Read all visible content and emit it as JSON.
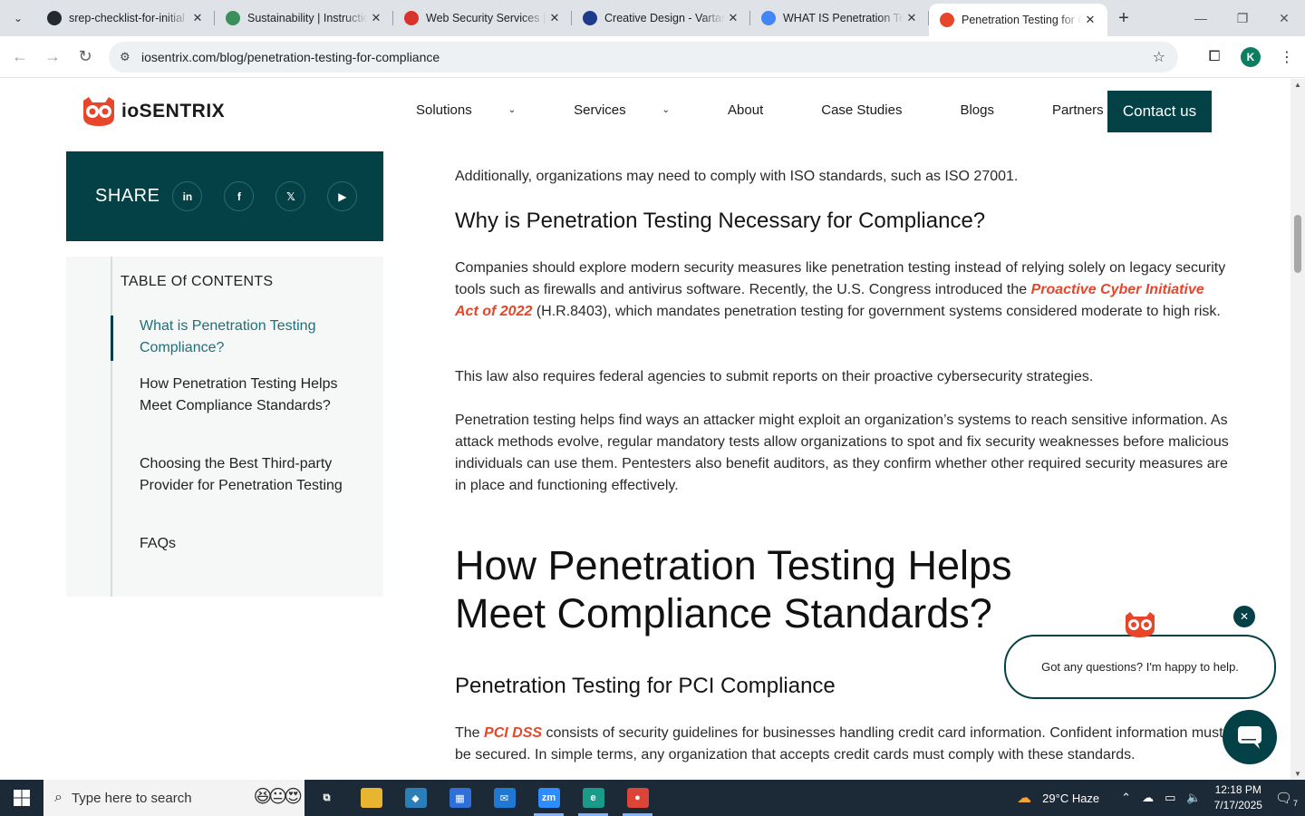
{
  "browser": {
    "tabs": [
      {
        "title": "srep-checklist-for-initial",
        "favicon": "github-icon",
        "color": "#24292f"
      },
      {
        "title": "Sustainability | Instructio",
        "favicon": "leaf-icon",
        "color": "#3a8f5a"
      },
      {
        "title": "Web Security Services |",
        "favicon": "shield-icon",
        "color": "#d9342b"
      },
      {
        "title": "Creative Design - Vartar",
        "favicon": "x-logo-icon",
        "color": "#1e3a8a"
      },
      {
        "title": "WHAT IS Penetration Te",
        "favicon": "google-icon",
        "color": "#4285f4"
      },
      {
        "title": "Penetration Testing for C",
        "favicon": "owl-icon",
        "color": "#e8462a",
        "active": true
      }
    ],
    "url": "iosentrix.com/blog/penetration-testing-for-compliance",
    "profile_initial": "K"
  },
  "site": {
    "brand": "ioSENTRIX",
    "nav": [
      {
        "label": "Solutions",
        "dropdown": true
      },
      {
        "label": "Services",
        "dropdown": true
      },
      {
        "label": "About"
      },
      {
        "label": "Case Studies"
      },
      {
        "label": "Blogs"
      },
      {
        "label": "Partners"
      }
    ],
    "contact_label": "Contact us",
    "accent": "#044147",
    "link_color": "#e8462a"
  },
  "share": {
    "label": "SHARE",
    "icons": [
      {
        "glyph": "in",
        "name": "linkedin-icon"
      },
      {
        "glyph": "f",
        "name": "facebook-icon"
      },
      {
        "glyph": "𝕏",
        "name": "x-twitter-icon"
      },
      {
        "glyph": "▶",
        "name": "youtube-icon"
      }
    ]
  },
  "toc": {
    "heading": "TABLE Of CONTENTS",
    "items": [
      "What is Penetration Testing Compliance?",
      "How Penetration Testing Helps Meet Compliance Standards?",
      "Choosing the Best Third-party Provider for Penetration Testing",
      "FAQs"
    ]
  },
  "article": {
    "p_iso": "Additionally, organizations may need to comply with ISO standards, such as ISO 27001.",
    "h2_why": "Why is Penetration Testing Necessary for Compliance?",
    "p1_before": "Companies should explore modern security measures like penetration testing instead of relying solely on legacy security tools such as firewalls and antivirus software. Recently, the U.S. Congress introduced the ",
    "p1_link": "Proactive Cyber Initiative Act of 2022",
    "p1_after": " (H.R.8403), which mandates penetration testing for government systems considered moderate to high risk.",
    "p2": "This law also requires federal agencies to submit reports on their proactive cybersecurity strategies.",
    "p3": "Penetration testing helps find ways an attacker might exploit an organization’s systems to reach sensitive information. As attack methods evolve, regular mandatory tests allow organizations to spot and fix security weaknesses before malicious individuals can use them. Pentesters also benefit auditors, as they confirm whether other required security measures are in place and functioning effectively.",
    "h1_how": "How Penetration Testing Helps Meet Compliance Standards?",
    "h2_pci": "Penetration Testing for PCI Compliance",
    "p4_before": "The ",
    "p4_link": "PCI DSS",
    "p4_after": " consists of security guidelines for businesses handling credit card information. Confident information must be secured. In simple terms, any organization that accepts credit cards must comply with these standards."
  },
  "chat": {
    "message": "Got any questions? I'm happy to help."
  },
  "taskbar": {
    "search_placeholder": "Type here to search",
    "apps": [
      {
        "name": "task-view-icon",
        "glyph": "⧉",
        "color": "transparent"
      },
      {
        "name": "file-explorer-icon",
        "glyph": "",
        "color": "#e8b530"
      },
      {
        "name": "vscode-icon",
        "glyph": "◆",
        "color": "#2b7fb8"
      },
      {
        "name": "store-icon",
        "glyph": "▦",
        "color": "#2f6fd6"
      },
      {
        "name": "mail-icon",
        "glyph": "✉",
        "color": "#1f78d1"
      },
      {
        "name": "zoom-icon",
        "glyph": "zm",
        "color": "#2d8cff"
      },
      {
        "name": "edge-icon",
        "glyph": "e",
        "color": "#1a9b8a"
      },
      {
        "name": "chrome-icon",
        "glyph": "●",
        "color": "#db4437"
      }
    ],
    "weather": "29°C  Haze",
    "time": "12:18 PM",
    "date": "7/17/2025",
    "notification_count": "7"
  }
}
